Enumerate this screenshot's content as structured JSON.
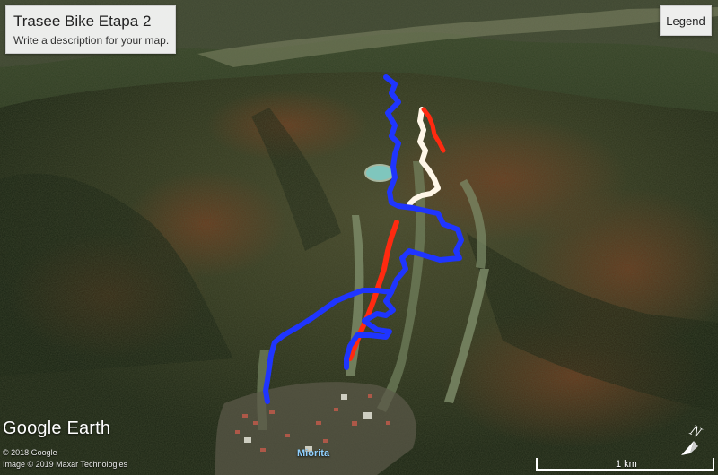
{
  "map": {
    "title": "Trasee Bike Etapa 2",
    "description": "Write a description for your map.",
    "legend_button": "Legend",
    "brand": "Google Earth",
    "copyright_1": "© 2018 Google",
    "copyright_2": "Image © 2019 Maxar Technologies",
    "place_label": "Miorita",
    "scale_label": "1 km",
    "compass_letter": "N"
  },
  "routes": [
    {
      "name": "blue-route",
      "color": "#1f35ff"
    },
    {
      "name": "red-route",
      "color": "#ff2a10"
    },
    {
      "name": "white-route",
      "color": "#fff7e8"
    }
  ],
  "colors": {
    "forest_dark": "#1f2a17",
    "ski_slope": "#7e8d6a",
    "lake": "#7fc6bd"
  }
}
